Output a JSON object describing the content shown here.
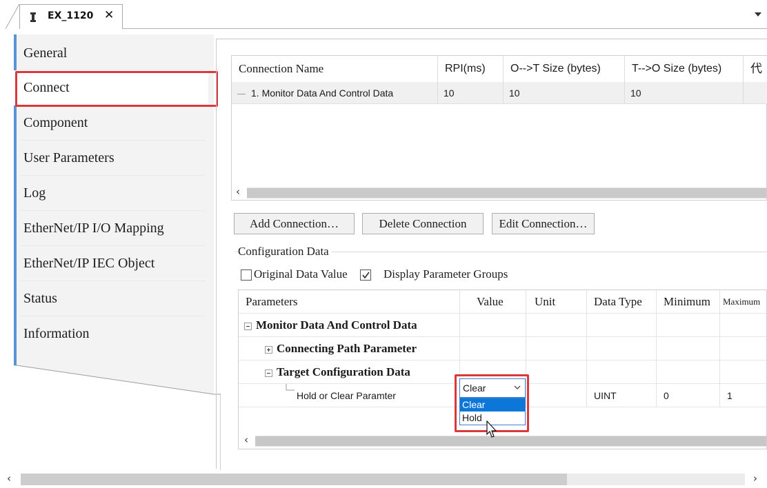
{
  "tab": {
    "title": "EX_1120",
    "close": "✕",
    "icon": "device-icon"
  },
  "nav": {
    "items": [
      {
        "label": "General"
      },
      {
        "label": "Connect"
      },
      {
        "label": "Component"
      },
      {
        "label": "User Parameters"
      },
      {
        "label": "Log"
      },
      {
        "label": "EtherNet/IP I/O Mapping"
      },
      {
        "label": "EtherNet/IP IEC Object"
      },
      {
        "label": "Status"
      },
      {
        "label": "Information"
      }
    ],
    "selected": "Connect"
  },
  "connections": {
    "columns": [
      "Connection Name",
      "RPI(ms)",
      "O-->T Size (bytes)",
      "T-->O Size (bytes)",
      "代"
    ],
    "rows": [
      {
        "name": "1. Monitor Data And Control Data",
        "rpi": "10",
        "ot_size": "10",
        "to_size": "10"
      }
    ]
  },
  "buttons": {
    "add": "Add Connection…",
    "delete": "Delete Connection",
    "edit": "Edit Connection…"
  },
  "config": {
    "caption": "Configuration Data",
    "original_label": "Original Data Value",
    "original_checked": false,
    "display_groups_label": "Display Parameter Groups",
    "display_groups_checked": true,
    "columns": [
      "Parameters",
      "Value",
      "Unit",
      "Data Type",
      "Minimum",
      "Maximum"
    ],
    "tree": {
      "root": "Monitor Data And Control Data",
      "child1": "Connecting Path Parameter",
      "child2": "Target Configuration Data",
      "param": {
        "name": "Hold or Clear Paramter",
        "value": "Clear",
        "unit": "",
        "data_type": "UINT",
        "minimum": "0",
        "maximum": "1"
      }
    },
    "dropdown_options": [
      "Clear",
      "Hold"
    ],
    "dropdown_selected": "Clear"
  },
  "colors": {
    "highlight": "#d9383c",
    "nav_accent": "#5a93d6",
    "selection": "#0d77d9"
  }
}
